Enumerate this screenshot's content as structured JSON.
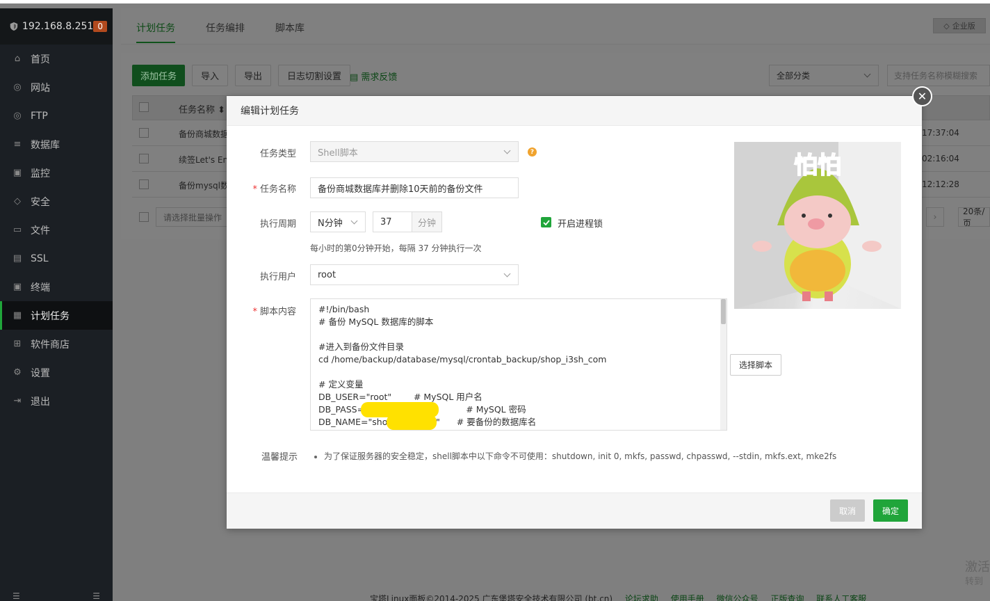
{
  "sidebar": {
    "host": "192.168.8.251",
    "badge": "0",
    "items": [
      {
        "label": "首页",
        "icon": "home-icon"
      },
      {
        "label": "网站",
        "icon": "globe-icon"
      },
      {
        "label": "FTP",
        "icon": "ftp-globe-icon"
      },
      {
        "label": "数据库",
        "icon": "database-icon"
      },
      {
        "label": "监控",
        "icon": "monitor-icon"
      },
      {
        "label": "安全",
        "icon": "shield-icon"
      },
      {
        "label": "文件",
        "icon": "folder-icon"
      },
      {
        "label": "SSL",
        "icon": "ssl-doc-icon"
      },
      {
        "label": "终端",
        "icon": "terminal-icon"
      },
      {
        "label": "计划任务",
        "icon": "calendar-icon"
      },
      {
        "label": "软件商店",
        "icon": "apps-icon"
      },
      {
        "label": "设置",
        "icon": "gear-icon"
      },
      {
        "label": "退出",
        "icon": "logout-icon"
      }
    ],
    "active_index": 9
  },
  "tabs": {
    "items": [
      "计划任务",
      "任务编排",
      "脚本库"
    ],
    "enterprise": "企业版"
  },
  "toolbar": {
    "add": "添加任务",
    "import": "导入",
    "export": "导出",
    "log_split": "日志切割设置",
    "feedback": "需求反馈",
    "category": "全部分类",
    "search_placeholder": "支持任务名称模糊搜索"
  },
  "table": {
    "header_name": "任务名称",
    "rows": [
      {
        "name": "备份商城数据",
        "time": "17:37:04"
      },
      {
        "name": "续签Let's Enc",
        "time": "02:16:04"
      },
      {
        "name": "备份mysql数",
        "time": "12:12:28"
      }
    ],
    "batch_placeholder": "请选择批量操作",
    "page_size": "20条/页"
  },
  "modal": {
    "title": "编辑计划任务",
    "labels": {
      "type": "任务类型",
      "name": "任务名称",
      "cycle": "执行周期",
      "user": "执行用户",
      "script": "脚本内容",
      "tip": "温馨提示"
    },
    "type_value": "Shell脚本",
    "name_value": "备份商城数据库并删除10天前的备份文件",
    "cycle_value": "N分钟",
    "minutes_value": "37",
    "minutes_unit": "分钟",
    "lock_label": "开启进程锁",
    "lock_checked": true,
    "cycle_hint": "每小时的第0分钟开始，每隔 37 分钟执行一次",
    "user_value": "root",
    "script_lines": [
      "#!/bin/bash",
      "# 备份 MySQL 数据库的脚本",
      "",
      "#进入到备份文件目录",
      "cd /home/backup/database/mysql/crontab_backup/shop_i3sh_com",
      "",
      "# 定义变量",
      "DB_USER=\"root\"        # MySQL 用户名",
      "DB_PASS=\"                    0P\"          # MySQL 密码",
      "DB_NAME=\"shop_              \"      # 要备份的数据库名"
    ],
    "select_script": "选择脚本",
    "tip_text": "为了保证服务器的安全稳定，shell脚本中以下命令不可使用：shutdown, init 0, mkfs, passwd, chpasswd, --stdin, mkfs.ext, mke2fs",
    "cancel": "取消",
    "confirm": "确定",
    "sticker_text": "怕怕"
  },
  "footer": {
    "copyright": "宝塔Linux面板©2014-2025 广东堡塔安全技术有限公司 (bt.cn)",
    "links": [
      "论坛求助",
      "使用手册",
      "微信公众号",
      "正版查询",
      "联系人工客服"
    ]
  },
  "watermark": {
    "line1": "激活",
    "line2": "转到"
  }
}
